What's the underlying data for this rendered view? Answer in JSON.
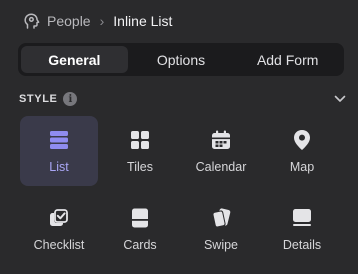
{
  "breadcrumb": {
    "parent": "People",
    "separator": "›",
    "current": "Inline List",
    "parent_icon": "person-head-icon"
  },
  "tabs": [
    {
      "label": "General",
      "active": true
    },
    {
      "label": "Options",
      "active": false
    },
    {
      "label": "Add Form",
      "active": false
    }
  ],
  "style_section": {
    "label": "STYLE",
    "info_glyph": "i",
    "collapse_icon": "chevron-down-icon",
    "selected": "List",
    "options": [
      {
        "label": "List",
        "icon": "list-icon"
      },
      {
        "label": "Tiles",
        "icon": "tiles-icon"
      },
      {
        "label": "Calendar",
        "icon": "calendar-icon"
      },
      {
        "label": "Map",
        "icon": "map-pin-icon"
      },
      {
        "label": "Checklist",
        "icon": "checklist-icon"
      },
      {
        "label": "Cards",
        "icon": "cards-icon"
      },
      {
        "label": "Swipe",
        "icon": "swipe-icon"
      },
      {
        "label": "Details",
        "icon": "details-icon"
      }
    ]
  },
  "colors": {
    "background": "#2a2a2c",
    "accent": "#8f8cf0",
    "selected_tile": "#3a3a4a",
    "icon": "#e4e4e7"
  }
}
